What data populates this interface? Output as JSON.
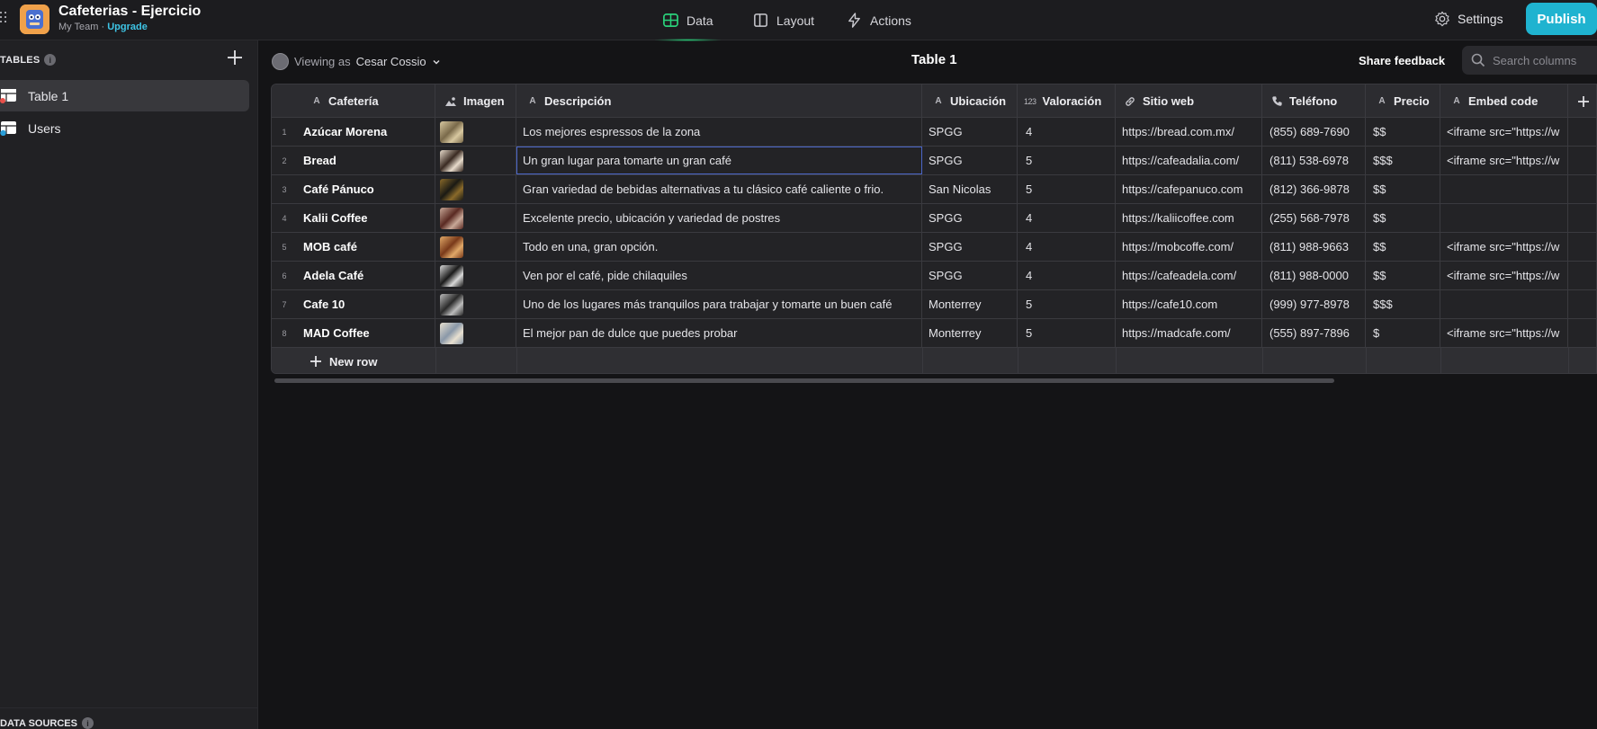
{
  "app": {
    "title": "Cafeterias - Ejercicio",
    "team": "My Team",
    "upgrade": "Upgrade"
  },
  "nav": {
    "data": "Data",
    "layout": "Layout",
    "actions": "Actions",
    "settings": "Settings",
    "publish": "Publish"
  },
  "sidebar": {
    "tables_heading": "TABLES",
    "items": [
      {
        "label": "Table 1"
      },
      {
        "label": "Users"
      }
    ],
    "data_sources_heading": "DATA SOURCES"
  },
  "toolbar": {
    "viewing_prefix": "Viewing as",
    "viewer_name": "Cesar Cossio",
    "table_title": "Table 1",
    "share_feedback": "Share feedback",
    "search_placeholder": "Search columns"
  },
  "columns": [
    {
      "label": "Cafetería",
      "type_icon": "A"
    },
    {
      "label": "Imagen",
      "type_icon": "image"
    },
    {
      "label": "Descripción",
      "type_icon": "A"
    },
    {
      "label": "Ubicación",
      "type_icon": "A"
    },
    {
      "label": "Valoración",
      "type_icon": "123"
    },
    {
      "label": "Sitio web",
      "type_icon": "link"
    },
    {
      "label": "Teléfono",
      "type_icon": "phone"
    },
    {
      "label": "Precio",
      "type_icon": "A"
    },
    {
      "label": "Embed code",
      "type_icon": "A"
    }
  ],
  "rows": [
    {
      "n": "1",
      "cafeteria": "Azúcar Morena",
      "descripcion": "Los mejores espressos de la zona",
      "ubicacion": "SPGG",
      "valoracion": "4",
      "sitio": "https://bread.com.mx/",
      "telefono": "(855) 689-7690",
      "precio": "$$",
      "embed": "<iframe src=\"https://w",
      "thumb": [
        "#7a6a4a",
        "#d8c8a0"
      ]
    },
    {
      "n": "2",
      "cafeteria": "Bread",
      "descripcion": "Un gran lugar para tomarte un gran café",
      "ubicacion": "SPGG",
      "valoracion": "5",
      "sitio": "https://cafeadalia.com/",
      "telefono": "(811) 538-6978",
      "precio": "$$$",
      "embed": "<iframe src=\"https://w",
      "thumb": [
        "#3a2a22",
        "#e8dccc"
      ]
    },
    {
      "n": "3",
      "cafeteria": "Café Pánuco",
      "descripcion": "Gran variedad de bebidas alternativas a tu clásico café caliente o frio.",
      "ubicacion": "San Nicolas",
      "valoracion": "5",
      "sitio": "https://cafepanuco.com",
      "telefono": "(812) 366-9878",
      "precio": "$$",
      "embed": "",
      "thumb": [
        "#1a1a14",
        "#8a6a2a"
      ]
    },
    {
      "n": "4",
      "cafeteria": "Kalii Coffee",
      "descripcion": "Excelente precio, ubicación y variedad de postres",
      "ubicacion": "SPGG",
      "valoracion": "4",
      "sitio": "https://kaliicoffee.com",
      "telefono": "(255) 568-7978",
      "precio": "$$",
      "embed": "",
      "thumb": [
        "#5a2a22",
        "#c8a898"
      ]
    },
    {
      "n": "5",
      "cafeteria": "MOB café",
      "descripcion": "Todo en una, gran opción.",
      "ubicacion": "SPGG",
      "valoracion": "4",
      "sitio": "https://mobcoffe.com/",
      "telefono": "(811) 988-9663",
      "precio": "$$",
      "embed": "<iframe src=\"https://w",
      "thumb": [
        "#7a3a1a",
        "#e0a868"
      ]
    },
    {
      "n": "6",
      "cafeteria": "Adela Café",
      "descripcion": "Ven por el café, pide chilaquiles",
      "ubicacion": "SPGG",
      "valoracion": "4",
      "sitio": "https://cafeadela.com/",
      "telefono": "(811) 988-0000",
      "precio": "$$",
      "embed": "<iframe src=\"https://w",
      "thumb": [
        "#1a1a1a",
        "#d8d8d8"
      ]
    },
    {
      "n": "7",
      "cafeteria": "Cafe 10",
      "descripcion": "Uno de los lugares más tranquilos para trabajar y tomarte un buen café",
      "ubicacion": "Monterrey",
      "valoracion": "5",
      "sitio": "https://cafe10.com",
      "telefono": "(999) 977-8978",
      "precio": "$$$",
      "embed": "",
      "thumb": [
        "#2a2a2a",
        "#bcbcbc"
      ]
    },
    {
      "n": "8",
      "cafeteria": "MAD Coffee",
      "descripcion": "El mejor pan de dulce que puedes probar",
      "ubicacion": "Monterrey",
      "valoracion": "5",
      "sitio": "https://madcafe.com/",
      "telefono": "(555) 897-7896",
      "precio": "$",
      "embed": "<iframe src=\"https://w",
      "thumb": [
        "#8a98a8",
        "#e8e0d0"
      ]
    }
  ],
  "new_row_label": "New row",
  "colors": {
    "accent_publish": "#1fb3d0",
    "upgrade": "#3ec5e6",
    "active_tab": "#2ad07a"
  }
}
